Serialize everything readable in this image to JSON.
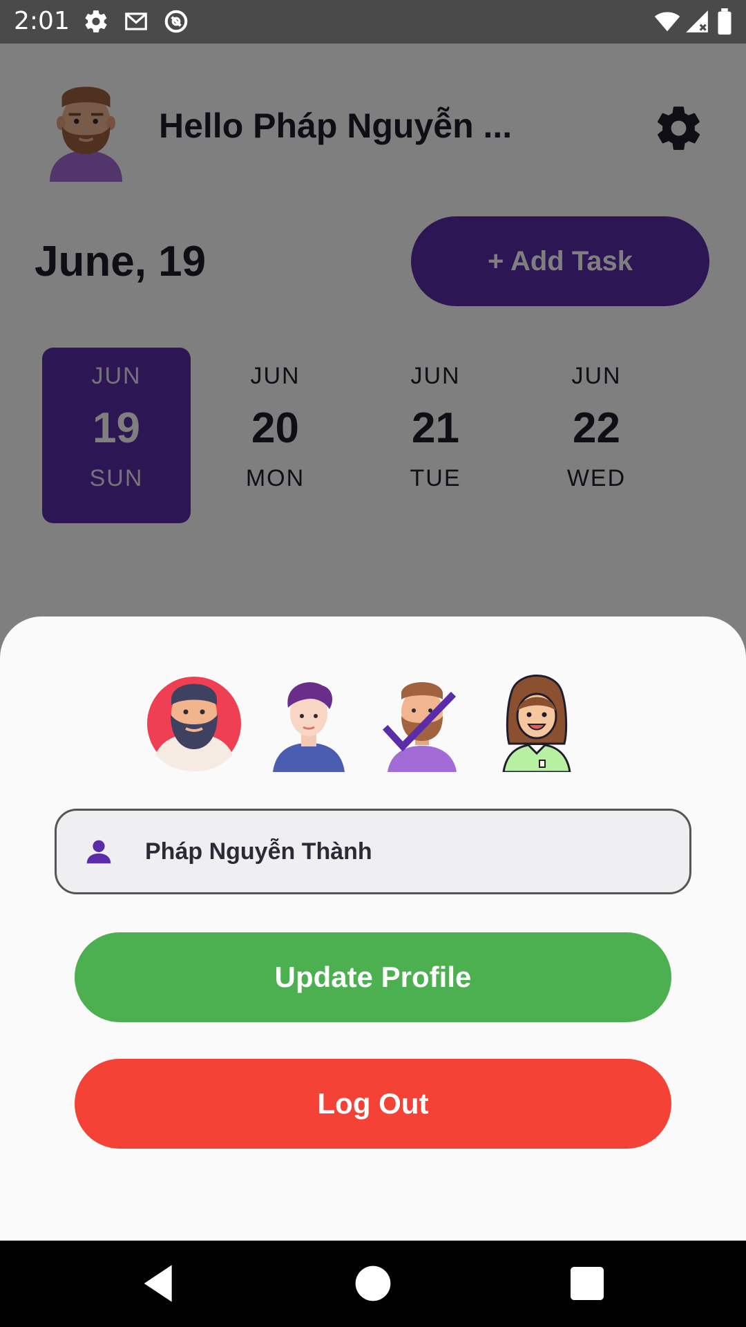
{
  "status_bar": {
    "time": "2:01",
    "icons": [
      "settings-icon",
      "gmail-icon",
      "sync-icon",
      "wifi-icon",
      "signal-icon",
      "battery-icon"
    ]
  },
  "header": {
    "greeting": "Hello Pháp Nguyễn ...",
    "avatar": "bearded-man-avatar",
    "settings_icon": "gear-icon"
  },
  "date_title": "June, 19",
  "add_task_label": "+ Add Task",
  "days": [
    {
      "month": "JUN",
      "day": "19",
      "weekday": "SUN",
      "selected": true
    },
    {
      "month": "JUN",
      "day": "20",
      "weekday": "MON",
      "selected": false
    },
    {
      "month": "JUN",
      "day": "21",
      "weekday": "TUE",
      "selected": false
    },
    {
      "month": "JUN",
      "day": "22",
      "weekday": "WED",
      "selected": false
    }
  ],
  "sheet": {
    "avatars": [
      {
        "name": "bearded-man-red-avatar",
        "selected": false
      },
      {
        "name": "young-man-avatar",
        "selected": false
      },
      {
        "name": "bearded-man-avatar",
        "selected": true
      },
      {
        "name": "woman-avatar",
        "selected": false
      }
    ],
    "name_value": "Pháp Nguyễn Thành",
    "update_label": "Update Profile",
    "logout_label": "Log Out"
  },
  "colors": {
    "primary": "#5a2ca8",
    "update": "#4caf50",
    "logout": "#f44336",
    "text_dark": "#1f1d2b"
  }
}
